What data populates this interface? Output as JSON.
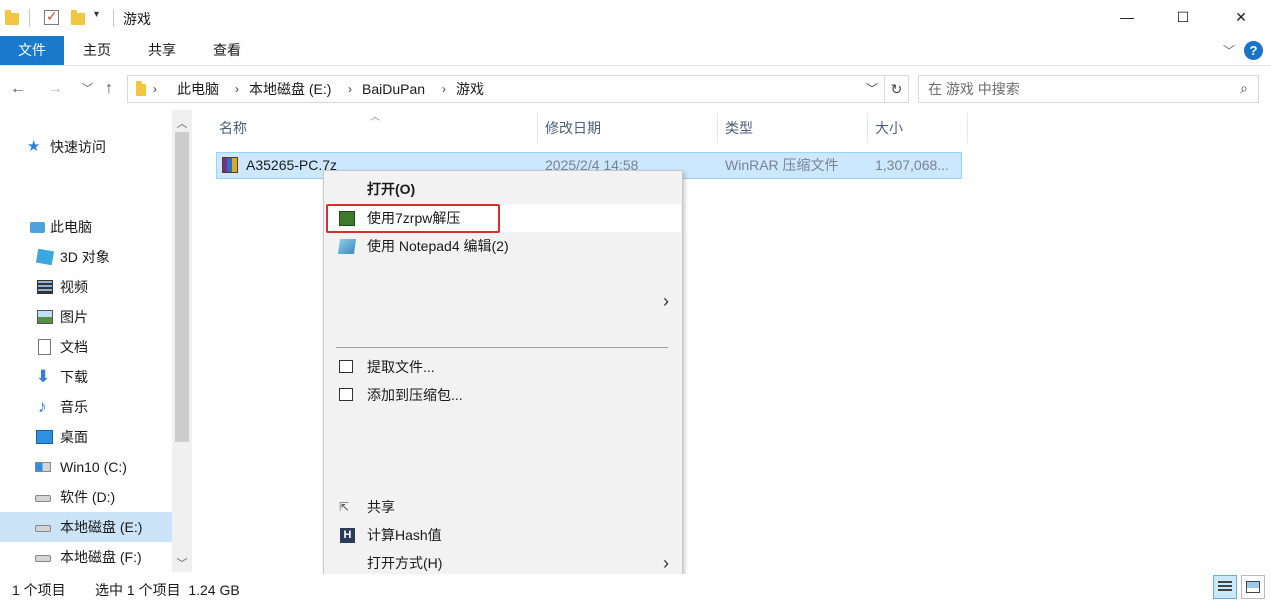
{
  "window": {
    "title": "游戏",
    "controls": {
      "minimize": "—",
      "maximize": "☐",
      "close": "✕"
    }
  },
  "ribbon": {
    "tabs": [
      {
        "label": "文件"
      },
      {
        "label": "主页"
      },
      {
        "label": "共享"
      },
      {
        "label": "查看"
      }
    ],
    "help_label": "?"
  },
  "address": {
    "crumbs": [
      "此电脑",
      "本地磁盘 (E:)",
      "BaiDuPan",
      "游戏"
    ],
    "separator": "›"
  },
  "search": {
    "placeholder": "在 游戏 中搜索"
  },
  "sidebar": {
    "items": [
      {
        "label": "快速访问",
        "icon": "star-icon"
      },
      {
        "label": "此电脑",
        "icon": "computer-icon"
      },
      {
        "label": "3D 对象",
        "icon": "cube-icon"
      },
      {
        "label": "视频",
        "icon": "film-icon"
      },
      {
        "label": "图片",
        "icon": "picture-icon"
      },
      {
        "label": "文档",
        "icon": "document-icon"
      },
      {
        "label": "下载",
        "icon": "download-icon"
      },
      {
        "label": "音乐",
        "icon": "music-icon"
      },
      {
        "label": "桌面",
        "icon": "desktop-icon"
      },
      {
        "label": "Win10 (C:)",
        "icon": "windows-drive-icon"
      },
      {
        "label": "软件 (D:)",
        "icon": "drive-icon"
      },
      {
        "label": "本地磁盘 (E:)",
        "icon": "drive-icon",
        "selected": true
      },
      {
        "label": "本地磁盘 (F:)",
        "icon": "drive-icon"
      }
    ]
  },
  "file_list": {
    "columns": [
      "名称",
      "修改日期",
      "类型",
      "大小"
    ],
    "rows": [
      {
        "name": "A35265-PC.7z",
        "modified": "2025/2/4 14:58",
        "type": "WinRAR 压缩文件",
        "size": "1,307,068...",
        "selected": true
      }
    ]
  },
  "context_menu": {
    "items": [
      {
        "label": "打开(O)",
        "bold": true
      },
      {
        "label": "使用7zrpw解压",
        "icon": "7zrpw-icon",
        "highlighted": true
      },
      {
        "label": "使用 Notepad4 编辑(2)",
        "icon": "notepad-icon"
      },
      {
        "label": "提取文件...",
        "icon": "winrar-icon"
      },
      {
        "label": "添加到压缩包...",
        "icon": "winrar-icon"
      },
      {
        "label": "共享",
        "icon": "share-icon"
      },
      {
        "label": "计算Hash值",
        "icon": "hash-icon"
      },
      {
        "label": "打开方式(H)"
      }
    ],
    "submenu_arrow": "›"
  },
  "status_bar": {
    "item_count": "1 个项目",
    "selection": "选中 1 个项目  1.24 GB"
  },
  "colors": {
    "accent": "#1979ca",
    "selection": "#cce8ff",
    "sidebar_selection": "#cce4f7",
    "highlight_box": "#d9302b"
  }
}
